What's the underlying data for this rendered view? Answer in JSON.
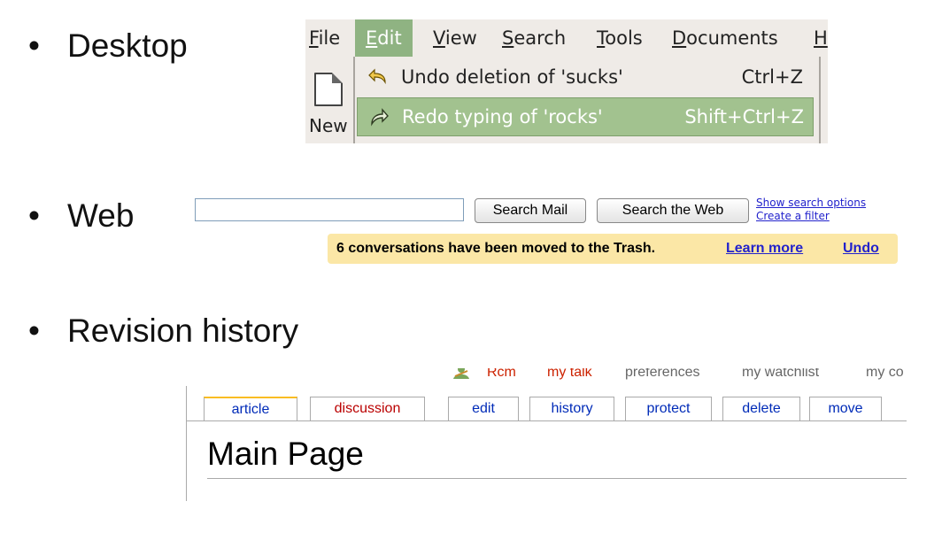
{
  "bullets": {
    "desktop": "Desktop",
    "web": "Web",
    "revision": "Revision history"
  },
  "desktop": {
    "menubar": [
      {
        "label": "File",
        "mnemonic": "F",
        "rest": "ile"
      },
      {
        "label": "Edit",
        "mnemonic": "E",
        "rest": "dit"
      },
      {
        "label": "View",
        "mnemonic": "V",
        "rest": "iew"
      },
      {
        "label": "Search",
        "mnemonic": "S",
        "rest": "earch"
      },
      {
        "label": "Tools",
        "mnemonic": "T",
        "rest": "ools"
      },
      {
        "label": "Documents",
        "mnemonic": "D",
        "rest": "ocuments"
      },
      {
        "label": "H",
        "mnemonic": "H",
        "rest": ""
      }
    ],
    "toolbar_new_label": "New",
    "menu_items": [
      {
        "label": "Undo deletion of 'sucks'",
        "shortcut": "Ctrl+Z",
        "icon": "undo-icon"
      },
      {
        "label": "Redo typing of 'rocks'",
        "shortcut": "Shift+Ctrl+Z",
        "icon": "redo-icon"
      }
    ],
    "colors": {
      "highlight": "#a2c28f",
      "menubar_active": "#8fb382",
      "background": "#efebe7"
    }
  },
  "web": {
    "search_value": "",
    "search_mail_button": "Search Mail",
    "search_web_button": "Search the Web",
    "show_options_link": "Show search options",
    "create_filter_link": "Create a filter",
    "notice_text": "6 conversations have been moved to the Trash.",
    "learn_more_link": "Learn more",
    "undo_link": "Undo",
    "colors": {
      "notice_bg": "#fbe7a6",
      "link": "#2222cc"
    }
  },
  "wiki": {
    "personal_tools": [
      "Rcm",
      "my talk",
      "preferences",
      "my watchlist",
      "my co"
    ],
    "tabs": [
      "article",
      "discussion",
      "edit",
      "history",
      "protect",
      "delete",
      "move"
    ],
    "page_title": "Main Page",
    "colors": {
      "selected_tab_border": "#fabd23",
      "red_link": "#ba0000",
      "blue_link": "#002bb8"
    }
  }
}
